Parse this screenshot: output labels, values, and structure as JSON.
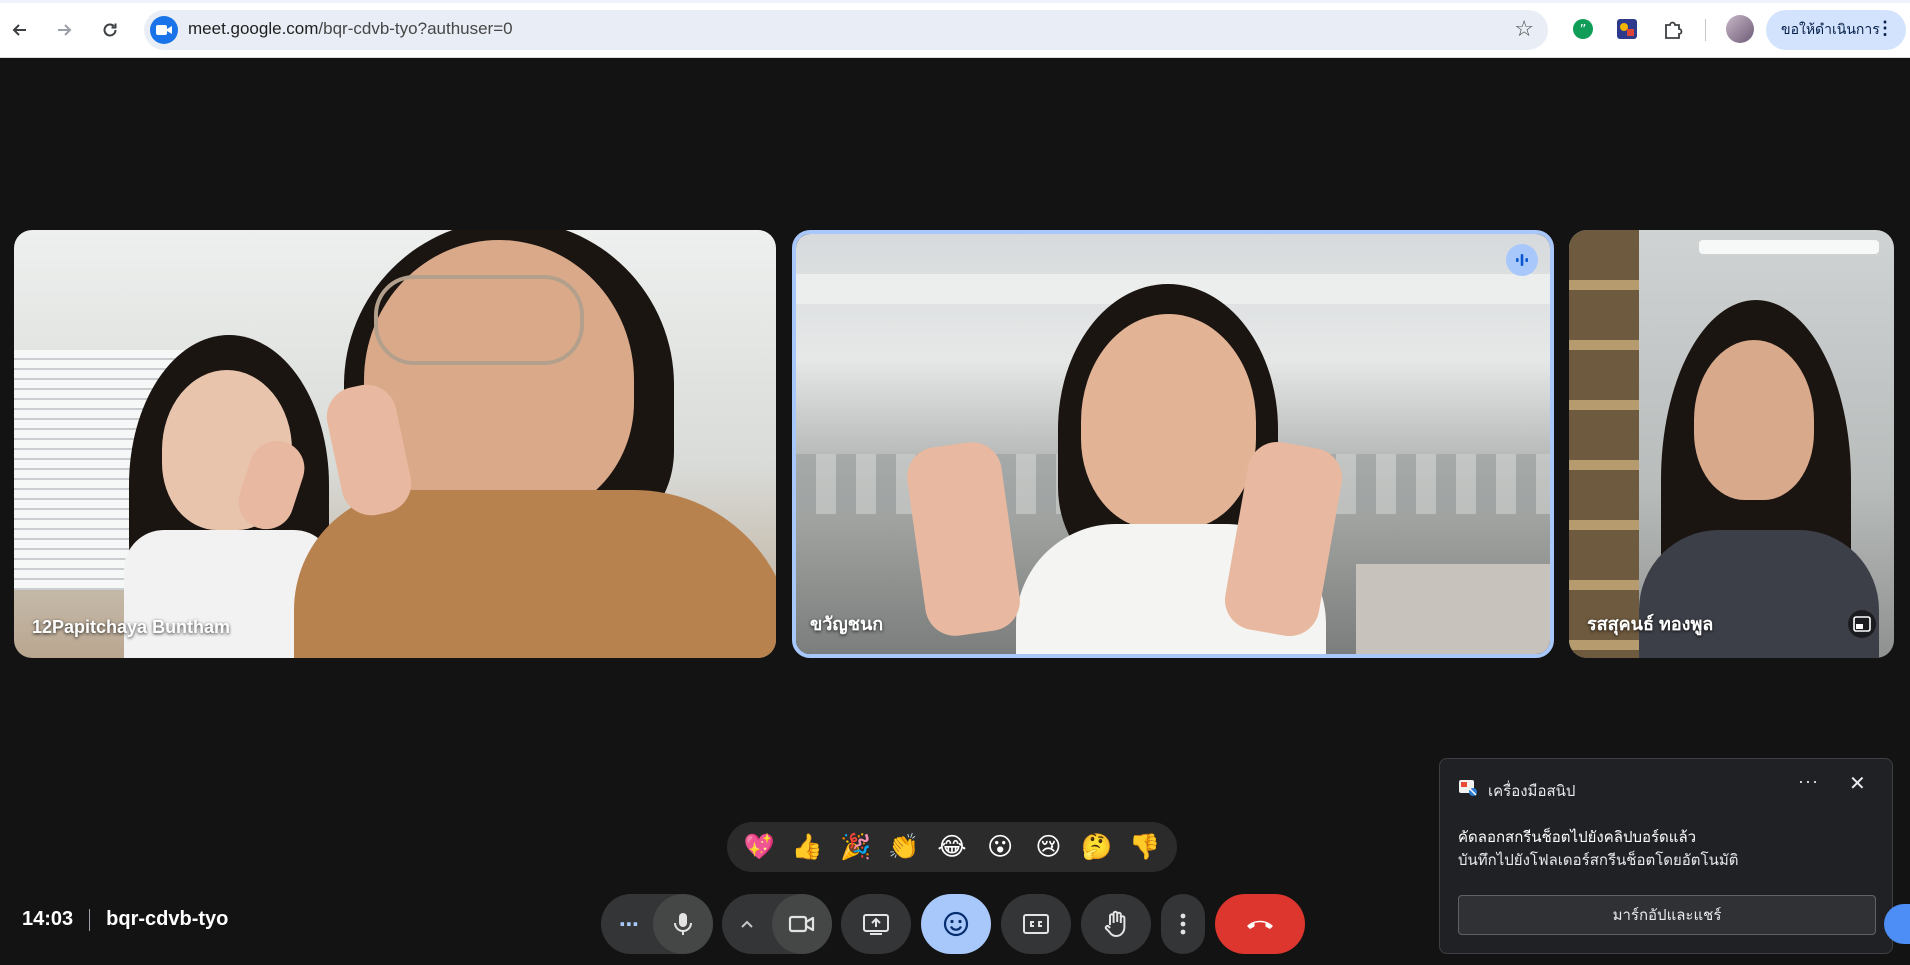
{
  "browser": {
    "url_host": "meet.google.com",
    "url_path": "/bqr-cdvb-tyo?authuser=0",
    "action_pill_label": "ขอให้ดำเนินการ",
    "extensions": [
      "quote-extension-icon",
      "puzzle-game-extension-icon",
      "extensions-puzzle-icon"
    ]
  },
  "participants": [
    {
      "name": "12Papitchaya Buntham",
      "speaking": false
    },
    {
      "name": "ขวัญชนก",
      "speaking": true
    },
    {
      "name": "รสสุคนธ์ ทองพูล",
      "speaking": false
    }
  ],
  "reactions": [
    "💖",
    "👍",
    "🎉",
    "👏",
    "😂",
    "😮",
    "😢",
    "🤔",
    "👎"
  ],
  "meeting": {
    "time": "14:03",
    "code": "bqr-cdvb-tyo"
  },
  "notification": {
    "app_name": "เครื่องมือสนิป",
    "message_line1": "คัดลอกสกรีนช็อตไปยังคลิปบอร์ดแล้ว",
    "message_line2": "บันทึกไปยังโฟลเดอร์สกรีนช็อตโดยอัตโนมัติ",
    "action_label": "มาร์กอัปและแชร์",
    "more_label": "···",
    "close_label": "✕"
  },
  "colors": {
    "background": "#131313",
    "active_speaker_border": "#a8c7fa",
    "end_call": "#dc362e",
    "control_bg": "#333537"
  }
}
